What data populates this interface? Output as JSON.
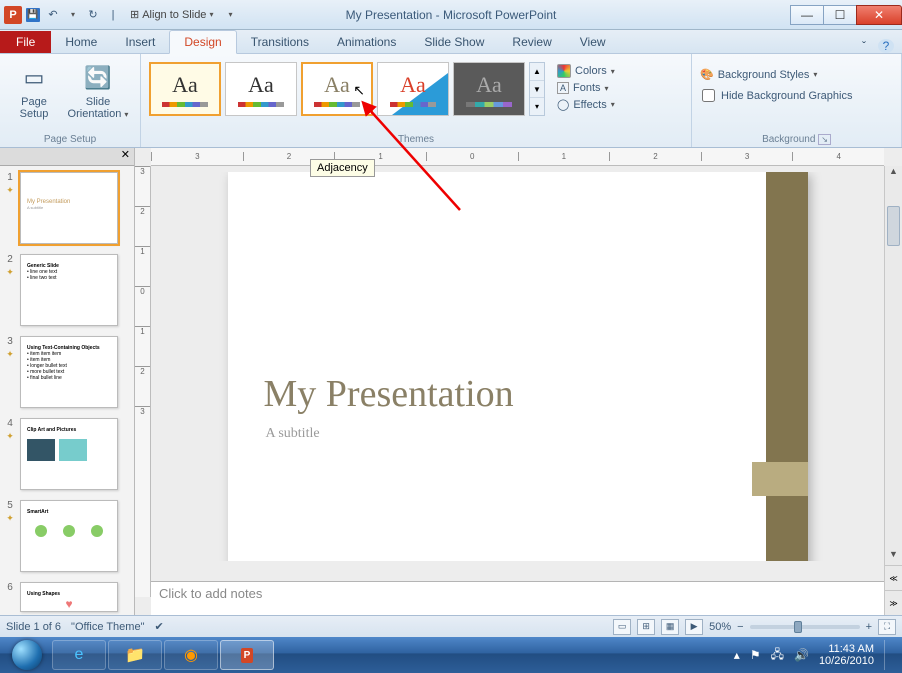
{
  "window": {
    "title": "My Presentation - Microsoft PowerPoint",
    "qat_align": "Align to Slide"
  },
  "tabs": {
    "file": "File",
    "home": "Home",
    "insert": "Insert",
    "design": "Design",
    "transitions": "Transitions",
    "animations": "Animations",
    "slideshow": "Slide Show",
    "review": "Review",
    "view": "View"
  },
  "ribbon": {
    "page_setup": {
      "label": "Page Setup",
      "page_setup_btn": "Page\nSetup",
      "orientation_btn": "Slide\nOrientation"
    },
    "themes": {
      "label": "Themes",
      "tooltip": "Adjacency",
      "colors": "Colors",
      "fonts": "Fonts",
      "effects": "Effects"
    },
    "background": {
      "label": "Background",
      "styles": "Background Styles",
      "hide": "Hide Background Graphics"
    }
  },
  "slides": {
    "s1": {
      "title": "My Presentation",
      "sub": "A subtitle"
    },
    "s2": {
      "title": "Generic Slide"
    },
    "s3": {
      "title": "Using Text-Containing Objects"
    },
    "s4": {
      "title": "Clip Art and Pictures"
    },
    "s5": {
      "title": "SmartArt"
    },
    "s6": {
      "title": "Using Shapes"
    }
  },
  "editor": {
    "slide_title": "My Presentation",
    "slide_sub": "A subtitle",
    "notes_placeholder": "Click to add notes"
  },
  "status": {
    "slide_of": "Slide 1 of 6",
    "theme": "\"Office Theme\"",
    "zoom": "50%"
  },
  "taskbar": {
    "time": "11:43 AM",
    "date": "10/26/2010"
  }
}
